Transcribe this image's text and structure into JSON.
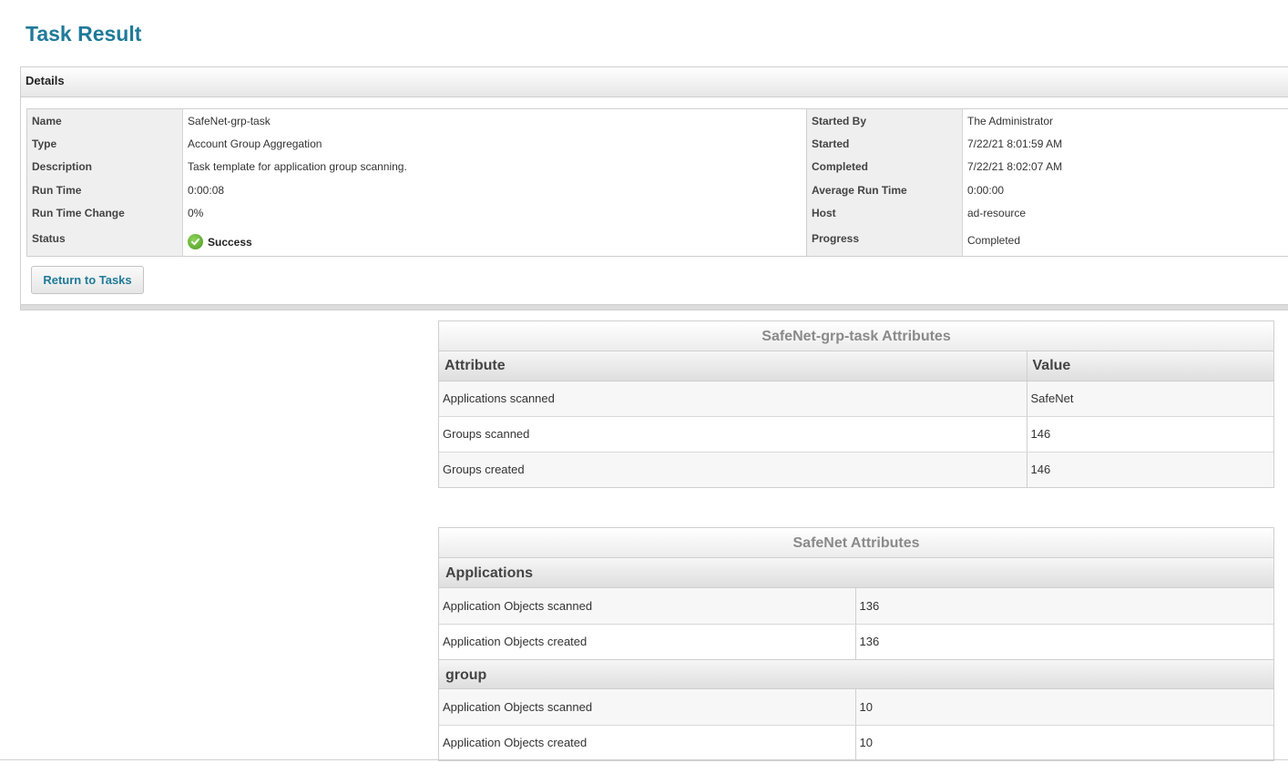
{
  "page": {
    "title": "Task Result"
  },
  "details": {
    "header": "Details",
    "left": [
      {
        "label": "Name",
        "value": "SafeNet-grp-task"
      },
      {
        "label": "Type",
        "value": "Account Group Aggregation"
      },
      {
        "label": "Description",
        "value": "Task template for application group scanning."
      },
      {
        "label": "Run Time",
        "value": "0:00:08"
      },
      {
        "label": "Run Time Change",
        "value": "0%"
      },
      {
        "label": "Status",
        "value": "Success"
      }
    ],
    "right": [
      {
        "label": "Started By",
        "value": "The Administrator"
      },
      {
        "label": "Started",
        "value": "7/22/21 8:01:59 AM"
      },
      {
        "label": "Completed",
        "value": "7/22/21 8:02:07 AM"
      },
      {
        "label": "Average Run Time",
        "value": "0:00:00"
      },
      {
        "label": "Host",
        "value": "ad-resource"
      },
      {
        "label": "Progress",
        "value": "Completed"
      }
    ],
    "status_icon": "success-check-icon",
    "return_button": "Return to Tasks"
  },
  "task_attributes": {
    "title": "SafeNet-grp-task Attributes",
    "col_attribute": "Attribute",
    "col_value": "Value",
    "rows": [
      {
        "attribute": "Applications scanned",
        "value": "SafeNet"
      },
      {
        "attribute": "Groups scanned",
        "value": "146"
      },
      {
        "attribute": "Groups created",
        "value": "146"
      }
    ]
  },
  "safenet_attributes": {
    "title": "SafeNet Attributes",
    "groups": [
      {
        "name": "Applications",
        "rows": [
          {
            "label": "Application Objects scanned",
            "value": "136"
          },
          {
            "label": "Application Objects created",
            "value": "136"
          }
        ]
      },
      {
        "name": "group",
        "rows": [
          {
            "label": "Application Objects scanned",
            "value": "10"
          },
          {
            "label": "Application Objects created",
            "value": "10"
          }
        ]
      }
    ]
  },
  "colors": {
    "title_blue": "#1f7a99",
    "success_green": "#4a9a22",
    "label_bg": "#efefef",
    "border": "#cfcfcf"
  }
}
